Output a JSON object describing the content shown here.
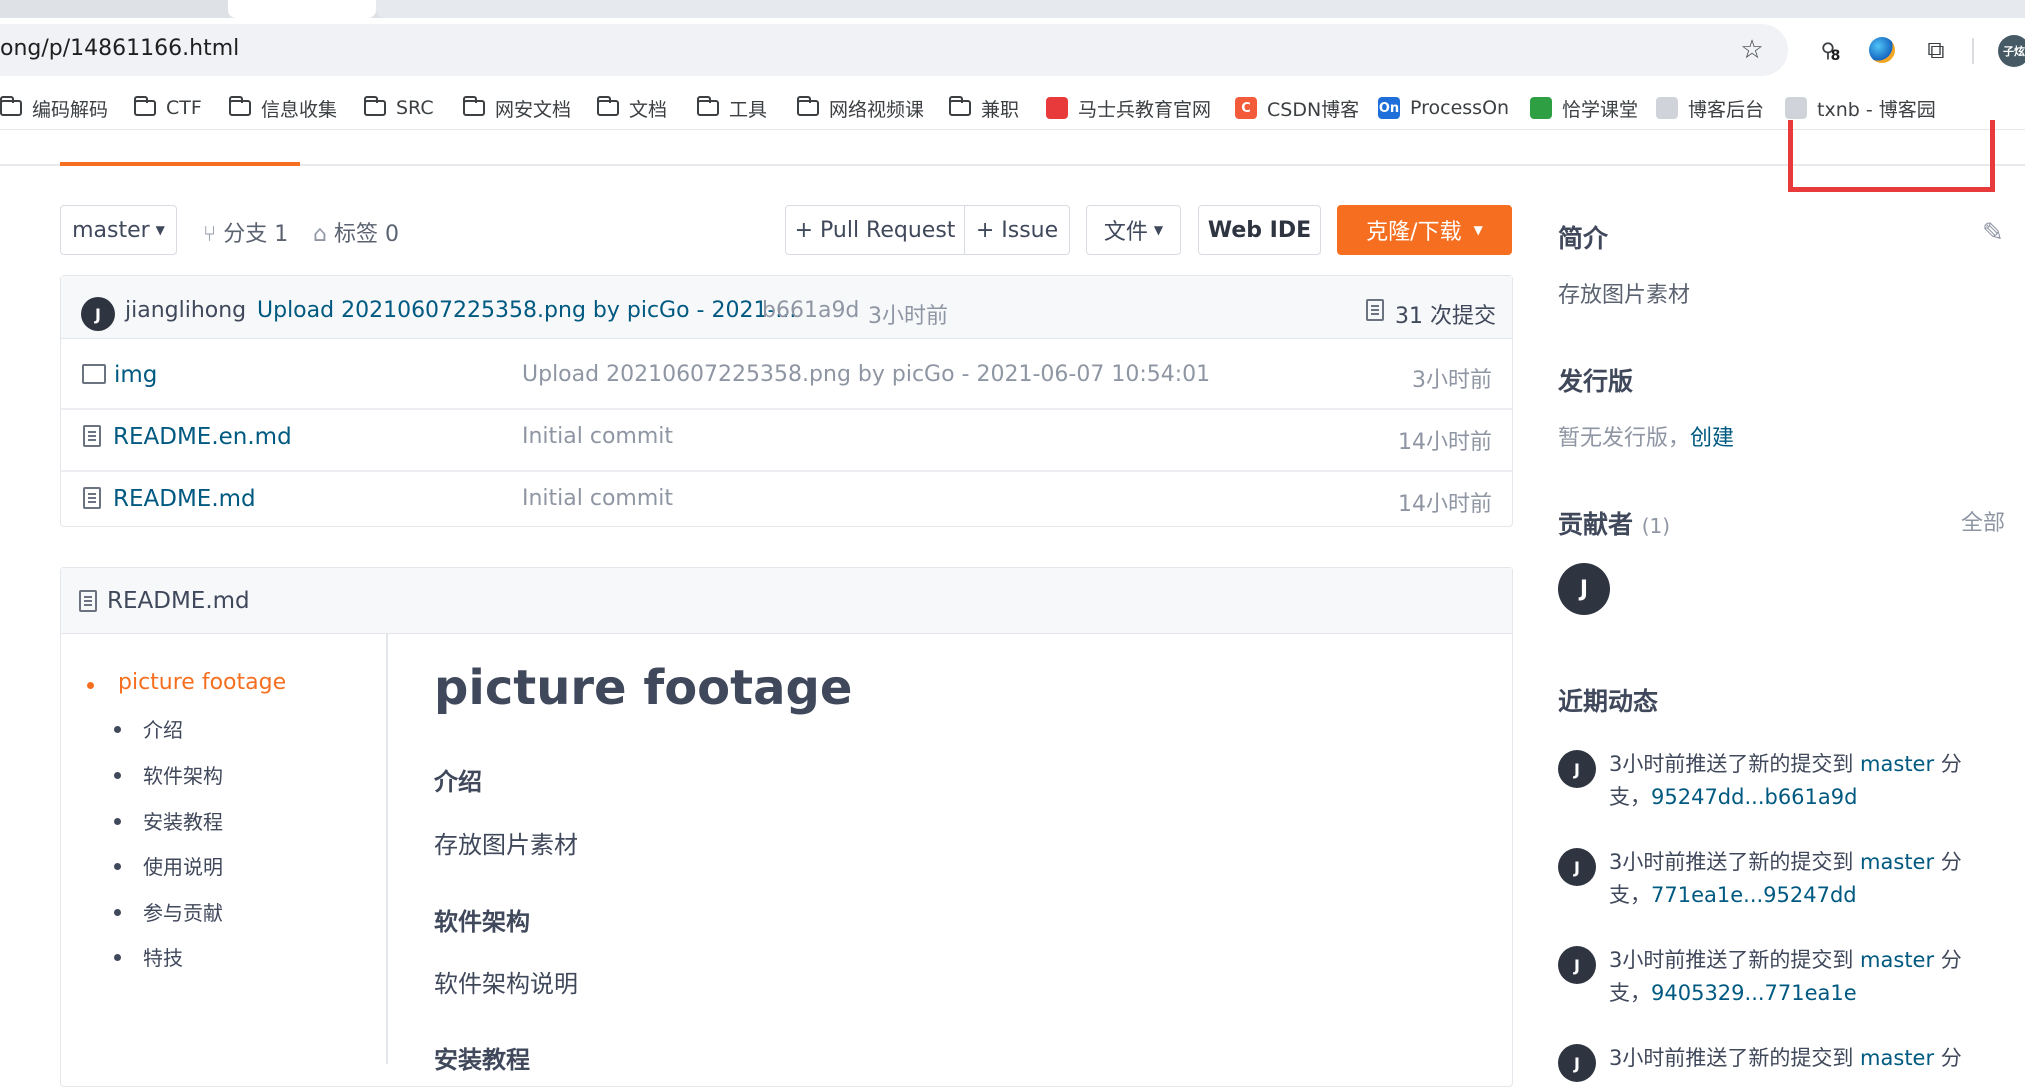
{
  "browser": {
    "url": "ong/p/14861166.html",
    "ext_badge": "8",
    "profile_initials": "子炫"
  },
  "bookmarks": [
    {
      "label": "编码解码",
      "type": "folder"
    },
    {
      "label": "CTF",
      "type": "folder"
    },
    {
      "label": "信息收集",
      "type": "folder"
    },
    {
      "label": "SRC",
      "type": "folder"
    },
    {
      "label": "网安文档",
      "type": "folder"
    },
    {
      "label": "文档",
      "type": "folder"
    },
    {
      "label": "工具",
      "type": "folder"
    },
    {
      "label": "网络视频课",
      "type": "folder"
    },
    {
      "label": "兼职",
      "type": "folder"
    },
    {
      "label": "马士兵教育官网",
      "type": "site",
      "icon_color": "#e8393b"
    },
    {
      "label": "CSDN博客",
      "type": "site",
      "icon_color": "#f45b3b",
      "icon_text": "C"
    },
    {
      "label": "ProcessOn",
      "type": "site",
      "icon_color": "#1e6fd9",
      "icon_text": "On"
    },
    {
      "label": "恰学课堂",
      "type": "site",
      "icon_color": "#2ea043"
    },
    {
      "label": "博客后台",
      "type": "site",
      "icon_color": "#d0d4da"
    },
    {
      "label": "txnb - 博客园",
      "type": "site",
      "icon_color": "#d0d4da"
    }
  ],
  "controls": {
    "branch": "master",
    "branches": "分支 1",
    "tags": "标签 0",
    "pull_request": "+ Pull Request",
    "issue": "+ Issue",
    "files": "文件",
    "web_ide": "Web IDE",
    "clone": "克隆/下载"
  },
  "commit": {
    "avatar": "J",
    "author": "jianglihong",
    "message": "Upload 20210607225358.png by picGo - 2021-...",
    "hash": "b661a9d",
    "time": "3小时前",
    "count": "31 次提交"
  },
  "files": [
    {
      "name": "img",
      "type": "folder",
      "message": "Upload 20210607225358.png by picGo - 2021-06-07 10:54:01",
      "time": "3小时前"
    },
    {
      "name": "README.en.md",
      "type": "file",
      "message": "Initial commit",
      "time": "14小时前"
    },
    {
      "name": "README.md",
      "type": "file",
      "message": "Initial commit",
      "time": "14小时前"
    }
  ],
  "readme": {
    "filename": "README.md",
    "toc": [
      "picture footage",
      "介绍",
      "软件架构",
      "安装教程",
      "使用说明",
      "参与贡献",
      "特技"
    ],
    "title": "picture footage",
    "sections": [
      {
        "heading": "介绍",
        "body": "存放图片素材"
      },
      {
        "heading": "软件架构",
        "body": "软件架构说明"
      },
      {
        "heading": "安装教程",
        "body": ""
      }
    ]
  },
  "sidebar": {
    "intro_title": "简介",
    "intro_text": "存放图片素材",
    "release_title": "发行版",
    "release_text": "暂无发行版，",
    "release_create": "创建",
    "contrib_title": "贡献者",
    "contrib_count": "(1)",
    "contrib_all": "全部",
    "contrib_avatar": "J",
    "activity_title": "近期动态",
    "activities": [
      {
        "avatar": "J",
        "prefix": "3小时前推送了新的提交到 ",
        "branch": "master",
        "suffix": " 分",
        "line2_prefix": "支，",
        "range": "95247dd...b661a9d"
      },
      {
        "avatar": "J",
        "prefix": "3小时前推送了新的提交到 ",
        "branch": "master",
        "suffix": " 分",
        "line2_prefix": "支，",
        "range": "771ea1e...95247dd"
      },
      {
        "avatar": "J",
        "prefix": "3小时前推送了新的提交到 ",
        "branch": "master",
        "suffix": " 分",
        "line2_prefix": "支，",
        "range": "9405329...771ea1e"
      },
      {
        "avatar": "J",
        "prefix": "3小时前推送了新的提交到 ",
        "branch": "master",
        "suffix": " 分",
        "line2_prefix": "",
        "range": ""
      }
    ]
  },
  "colors": {
    "accent": "#f66f20",
    "link": "#005980",
    "highlight_box": "#e8393b"
  }
}
